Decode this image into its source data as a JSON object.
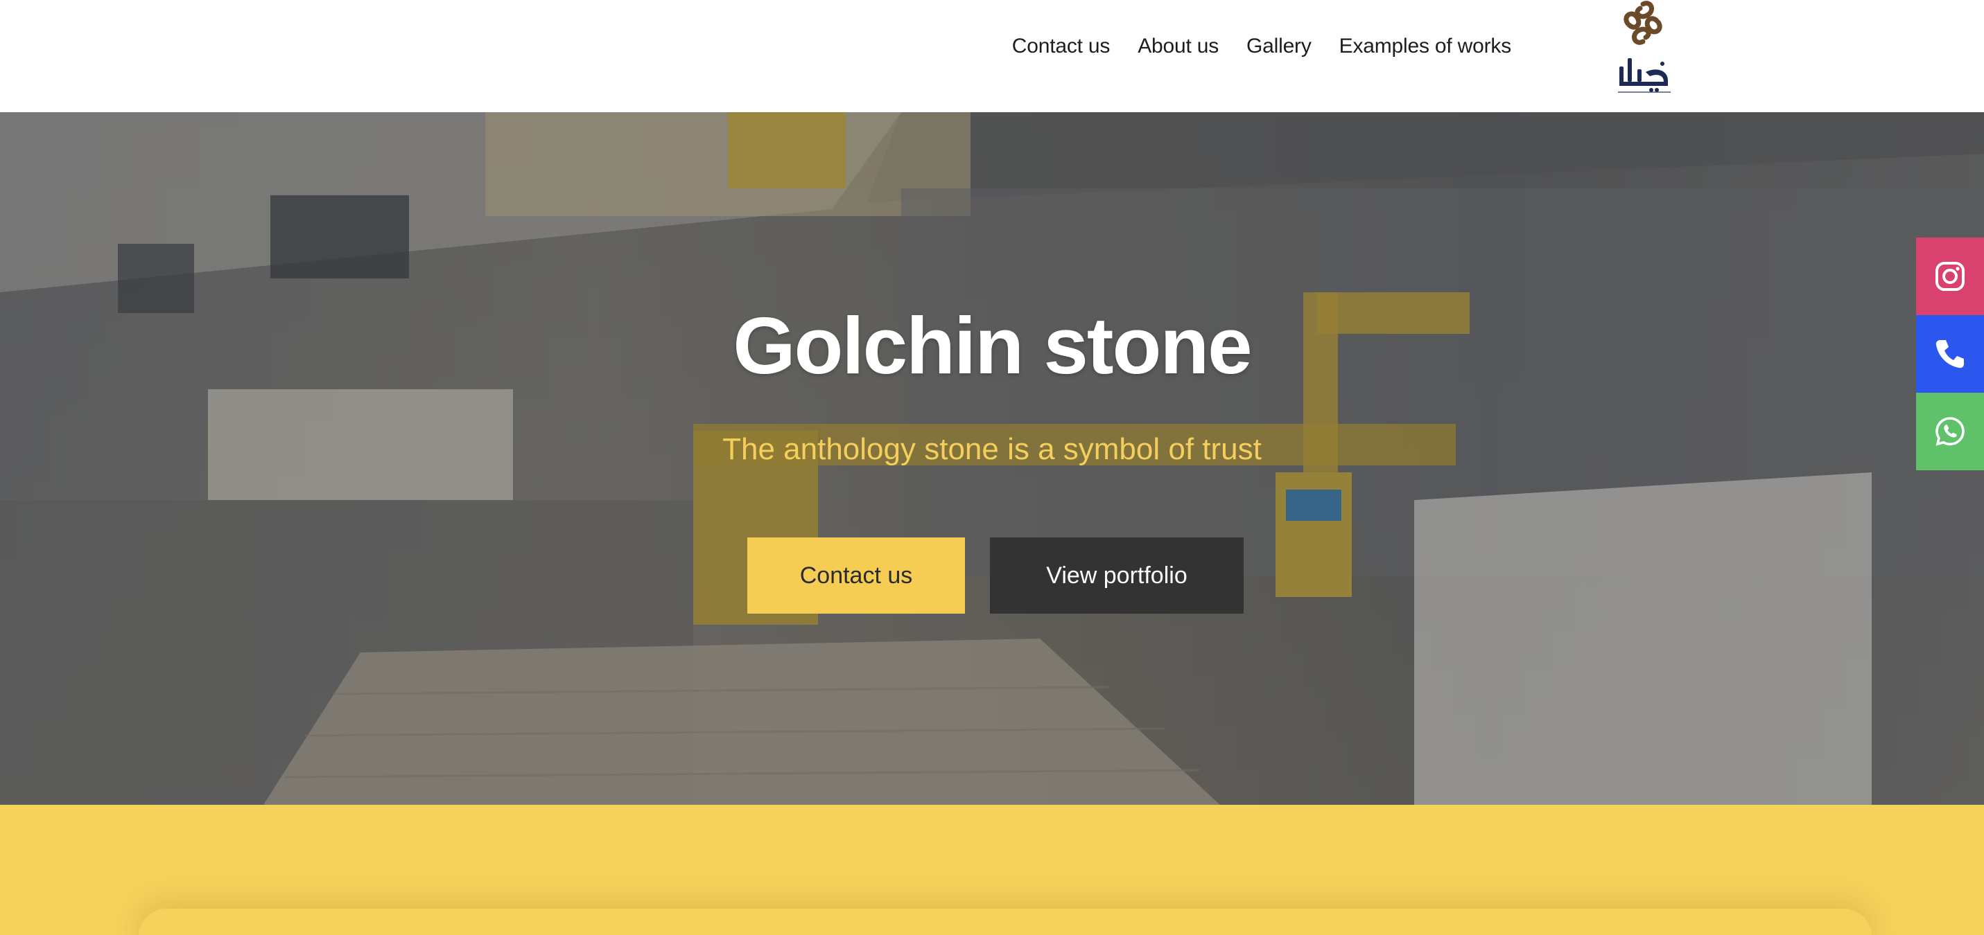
{
  "nav": {
    "items": [
      {
        "label": "Contact us"
      },
      {
        "label": "About us"
      },
      {
        "label": "Gallery"
      },
      {
        "label": "Examples of works"
      }
    ]
  },
  "logo": {
    "icon": "golchin-logo-icon",
    "text": "گلچین"
  },
  "hero": {
    "title": "Golchin stone",
    "subtitle": "The anthology stone is a symbol of trust",
    "primary_button": "Contact us",
    "secondary_button": "View portfolio"
  },
  "social": [
    {
      "name": "instagram-icon",
      "color": "#d9426f"
    },
    {
      "name": "phone-icon",
      "color": "#2c57ee"
    },
    {
      "name": "whatsapp-icon",
      "color": "#5fc26a"
    }
  ],
  "colors": {
    "accent_yellow": "#f5cd55",
    "dark_button": "#333333",
    "subtitle_yellow": "#f4cf5b"
  }
}
